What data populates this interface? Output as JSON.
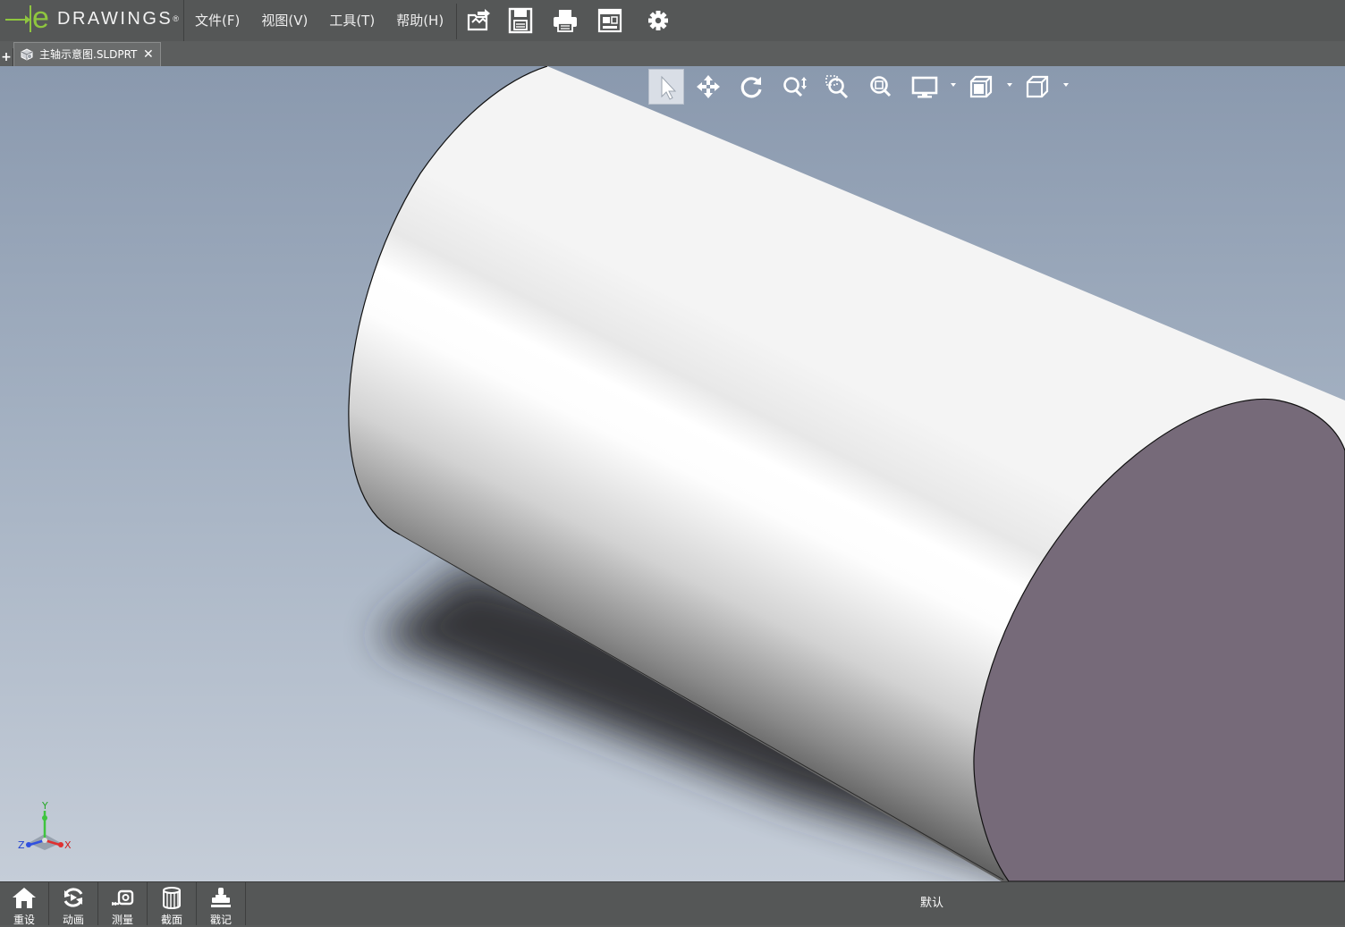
{
  "app": {
    "logo_letter": "e",
    "logo_text": "DRAWINGS",
    "logo_mark": "®"
  },
  "menu": [
    {
      "label": "文件(F)"
    },
    {
      "label": "视图(V)"
    },
    {
      "label": "工具(T)"
    },
    {
      "label": "帮助(H)"
    }
  ],
  "toolbar": [
    {
      "icon": "open-file-icon"
    },
    {
      "icon": "save-icon"
    },
    {
      "icon": "print-icon"
    },
    {
      "icon": "sheet-layout-icon"
    },
    {
      "icon": "settings-gear-icon"
    }
  ],
  "tabs": {
    "add_label": "+",
    "items": [
      {
        "label": "主轴示意图.SLDPRT",
        "close": "✕",
        "icon": "part-file-icon"
      }
    ]
  },
  "view_toolbar": [
    {
      "icon": "select-arrow-icon",
      "active": true
    },
    {
      "icon": "pan-icon"
    },
    {
      "icon": "rotate-icon"
    },
    {
      "icon": "zoom-icon"
    },
    {
      "icon": "zoom-to-area-icon"
    },
    {
      "icon": "zoom-to-fit-icon"
    },
    {
      "icon": "display-style-icon",
      "dropdown": true
    },
    {
      "icon": "view-orientation-icon",
      "dropdown": true
    },
    {
      "icon": "standard-views-cube-icon",
      "dropdown": true
    }
  ],
  "triad": {
    "x": "X",
    "y": "Y",
    "z": "Z"
  },
  "bottom_bar": {
    "buttons": [
      {
        "label": "重设",
        "icon": "home-icon"
      },
      {
        "label": "动画",
        "icon": "animate-icon"
      },
      {
        "label": "测量",
        "icon": "measure-icon"
      },
      {
        "label": "截面",
        "icon": "section-icon"
      },
      {
        "label": "戳记",
        "icon": "stamp-icon"
      }
    ],
    "configuration": "默认"
  },
  "colors": {
    "brand_green": "#8fc63f",
    "chrome": "#555757",
    "model_end_face": "#766a79"
  }
}
